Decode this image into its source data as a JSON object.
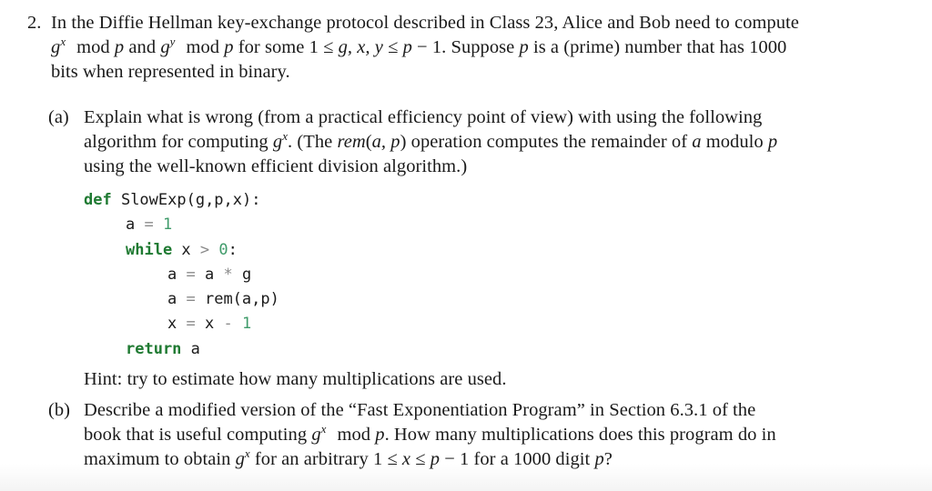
{
  "question": {
    "number": "2.",
    "intro_lines": [
      {
        "segments": [
          {
            "t": "text",
            "v": "In the Diffie Hellman key-exchange protocol described in Class 23, Alice and Bob need to compute"
          }
        ]
      },
      {
        "segments": [
          {
            "t": "math",
            "v": "g"
          },
          {
            "t": "sup",
            "v": "x"
          },
          {
            "t": "gap",
            "v": ""
          },
          {
            "t": "mathr",
            "v": "mod "
          },
          {
            "t": "math",
            "v": "p"
          },
          {
            "t": "text",
            "v": " and "
          },
          {
            "t": "math",
            "v": "g"
          },
          {
            "t": "sup",
            "v": "y"
          },
          {
            "t": "gap",
            "v": ""
          },
          {
            "t": "mathr",
            "v": "mod "
          },
          {
            "t": "math",
            "v": "p"
          },
          {
            "t": "text",
            "v": " for some "
          },
          {
            "t": "mathr",
            "v": "1 ≤ "
          },
          {
            "t": "math",
            "v": "g, x, y"
          },
          {
            "t": "mathr",
            "v": " ≤ "
          },
          {
            "t": "math",
            "v": "p"
          },
          {
            "t": "mathr",
            "v": " − 1"
          },
          {
            "t": "text",
            "v": ". Suppose "
          },
          {
            "t": "math",
            "v": "p"
          },
          {
            "t": "text",
            "v": " is a (prime) number that has 1000"
          }
        ]
      },
      {
        "segments": [
          {
            "t": "text",
            "v": "bits when represented in binary."
          }
        ]
      }
    ]
  },
  "part_a": {
    "label": "(a)",
    "lines": [
      {
        "segments": [
          {
            "t": "text",
            "v": "Explain what is wrong (from a practical efficiency point of view) with using the following"
          }
        ]
      },
      {
        "segments": [
          {
            "t": "text",
            "v": "algorithm for computing "
          },
          {
            "t": "math",
            "v": "g"
          },
          {
            "t": "sup",
            "v": "x"
          },
          {
            "t": "text",
            "v": ". (The "
          },
          {
            "t": "math",
            "v": "rem"
          },
          {
            "t": "mathr",
            "v": "("
          },
          {
            "t": "math",
            "v": "a, p"
          },
          {
            "t": "mathr",
            "v": ")"
          },
          {
            "t": "text",
            "v": " operation computes the remainder of "
          },
          {
            "t": "math",
            "v": "a"
          },
          {
            "t": "text",
            "v": " modulo "
          },
          {
            "t": "math",
            "v": "p"
          }
        ]
      },
      {
        "segments": [
          {
            "t": "text",
            "v": "using the well-known efficient division algorithm.)"
          }
        ]
      }
    ],
    "code": [
      {
        "indent": 0,
        "tokens": [
          {
            "c": "kw",
            "v": "def"
          },
          {
            "c": "",
            "v": " SlowExp(g,p,x):"
          }
        ]
      },
      {
        "indent": 1,
        "tokens": [
          {
            "c": "",
            "v": "a "
          },
          {
            "c": "op",
            "v": "="
          },
          {
            "c": "",
            "v": " "
          },
          {
            "c": "nu",
            "v": "1"
          }
        ]
      },
      {
        "indent": 1,
        "tokens": [
          {
            "c": "kw",
            "v": "while"
          },
          {
            "c": "",
            "v": " x "
          },
          {
            "c": "op",
            "v": ">"
          },
          {
            "c": "",
            "v": " "
          },
          {
            "c": "nu",
            "v": "0"
          },
          {
            "c": "",
            "v": ":"
          }
        ]
      },
      {
        "indent": 2,
        "tokens": [
          {
            "c": "",
            "v": "a "
          },
          {
            "c": "op",
            "v": "="
          },
          {
            "c": "",
            "v": " a "
          },
          {
            "c": "op",
            "v": "*"
          },
          {
            "c": "",
            "v": " g"
          }
        ]
      },
      {
        "indent": 2,
        "tokens": [
          {
            "c": "",
            "v": "a "
          },
          {
            "c": "op",
            "v": "="
          },
          {
            "c": "",
            "v": " rem(a,p)"
          }
        ]
      },
      {
        "indent": 2,
        "tokens": [
          {
            "c": "",
            "v": "x "
          },
          {
            "c": "op",
            "v": "="
          },
          {
            "c": "",
            "v": " x "
          },
          {
            "c": "op",
            "v": "-"
          },
          {
            "c": "",
            "v": " "
          },
          {
            "c": "nu",
            "v": "1"
          }
        ]
      },
      {
        "indent": 1,
        "tokens": [
          {
            "c": "kw",
            "v": "return"
          },
          {
            "c": "",
            "v": " a"
          }
        ]
      }
    ],
    "hint": "Hint: try to estimate how many multiplications are used."
  },
  "part_b": {
    "label": "(b)",
    "lines": [
      {
        "segments": [
          {
            "t": "text",
            "v": "Describe a modified version of the “Fast Exponentiation Program” in Section 6.3.1 of the"
          }
        ]
      },
      {
        "segments": [
          {
            "t": "text",
            "v": "book that is useful computing "
          },
          {
            "t": "math",
            "v": "g"
          },
          {
            "t": "sup",
            "v": "x"
          },
          {
            "t": "gap",
            "v": ""
          },
          {
            "t": "mathr",
            "v": "mod "
          },
          {
            "t": "math",
            "v": "p"
          },
          {
            "t": "text",
            "v": ". How many multiplications does this program do in"
          }
        ]
      },
      {
        "segments": [
          {
            "t": "text",
            "v": "maximum to obtain "
          },
          {
            "t": "math",
            "v": "g"
          },
          {
            "t": "sup",
            "v": "x"
          },
          {
            "t": "text",
            "v": " for an arbitrary "
          },
          {
            "t": "mathr",
            "v": "1 ≤ "
          },
          {
            "t": "math",
            "v": "x"
          },
          {
            "t": "mathr",
            "v": " ≤ "
          },
          {
            "t": "math",
            "v": "p"
          },
          {
            "t": "mathr",
            "v": " − 1"
          },
          {
            "t": "text",
            "v": " for a 1000 digit "
          },
          {
            "t": "math",
            "v": "p"
          },
          {
            "t": "text",
            "v": "?"
          }
        ]
      }
    ]
  },
  "colors": {
    "keyword": "#1f7a32",
    "number": "#3f9b6a",
    "operator": "#8a8a8a",
    "text": "#1a1a1a"
  }
}
